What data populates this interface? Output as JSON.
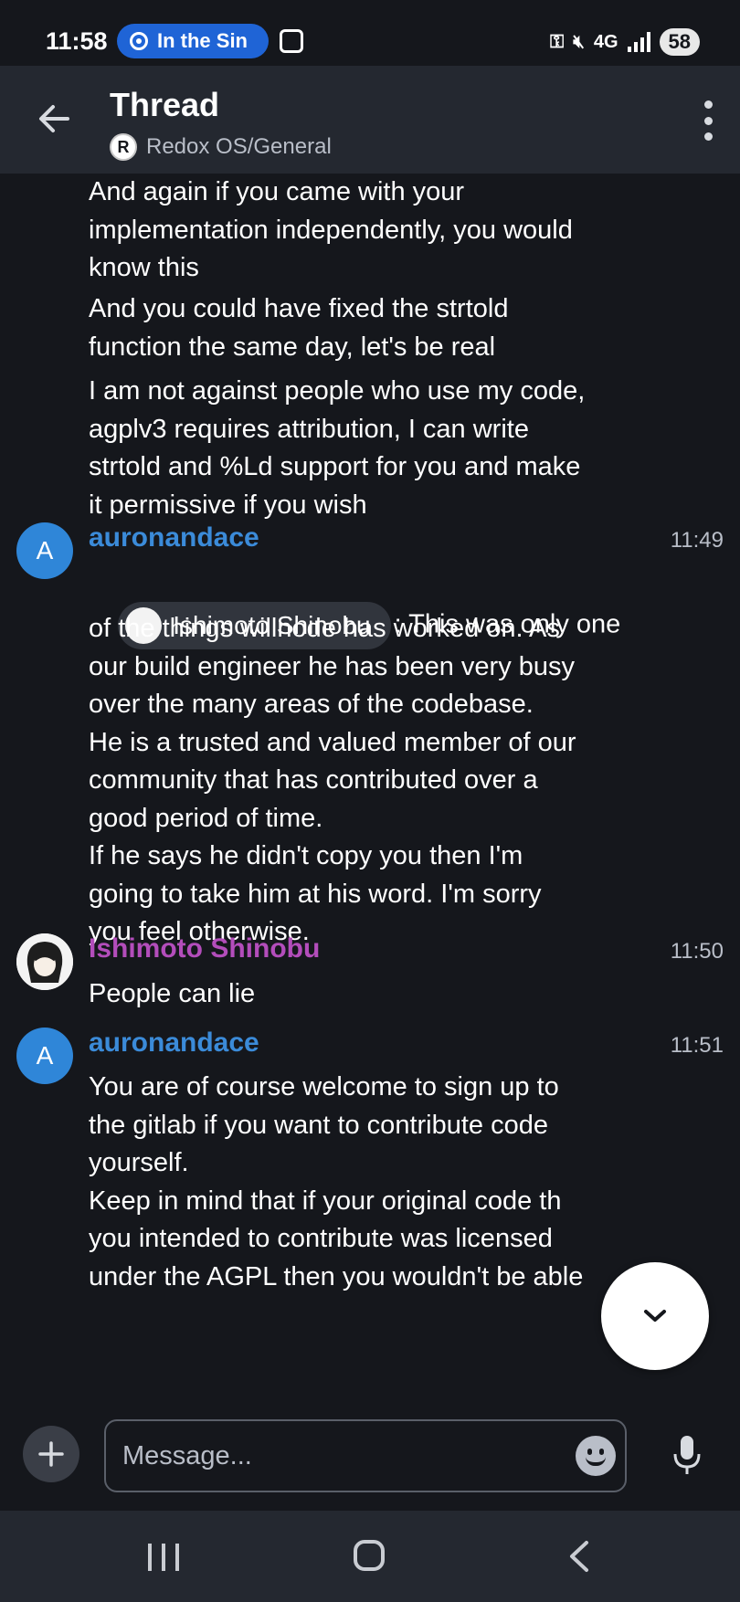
{
  "status_bar": {
    "time": "11:58",
    "notification_pill": "In the Sin",
    "network_label": "4G",
    "battery": "58"
  },
  "header": {
    "title": "Thread",
    "room_icon_letter": "R",
    "room_name": "Redox OS/General"
  },
  "messages": {
    "m0": {
      "paragraphs": [
        "And again if you came with your\nimplementation independently, you would\nknow this",
        "And you could have fixed the strtold\nfunction the same day, let's be real",
        "I am not against people who use my code,\nagplv3 requires attribution, I can write\nstrtold and %Ld support for you and make\nit permissive if you wish"
      ]
    },
    "m1": {
      "sender": "auronandace",
      "avatar_letter": "A",
      "time": "11:49",
      "mention": "Ishimoto Shinobu",
      "text_after_mention": ": This was only one",
      "body": "of the things willnode has worked on. As\nour build engineer he has been very busy\nover the many areas of the codebase.\nHe is a trusted and valued member of our\ncommunity that has contributed over a\ngood period of time.\nIf he says he didn't copy you then I'm\ngoing to take him at his word. I'm sorry\nyou feel otherwise."
    },
    "m2": {
      "sender": "Ishimoto Shinobu",
      "time": "11:50",
      "body": "People can lie"
    },
    "m3": {
      "sender": "auronandace",
      "avatar_letter": "A",
      "time": "11:51",
      "body": "You are of course welcome to sign up to\nthe gitlab if you want to contribute code\nyourself.\nKeep in mind that if your original code th\nyou intended to contribute was licensed\nunder the AGPL then you wouldn't be able"
    }
  },
  "composer": {
    "placeholder": "Message..."
  },
  "colors": {
    "background": "#15171c",
    "header": "#242830",
    "sender_blue": "#3b8bd9",
    "sender_purple": "#b34dbb",
    "avatar_blue": "#2f86d8",
    "pill_blue": "#1f64d6"
  },
  "icons": {
    "back": "arrow-left-icon",
    "more": "more-vertical-icon",
    "scroll_down": "chevron-down-icon",
    "add": "plus-icon",
    "emoji": "emoji-icon",
    "mic": "microphone-icon"
  }
}
